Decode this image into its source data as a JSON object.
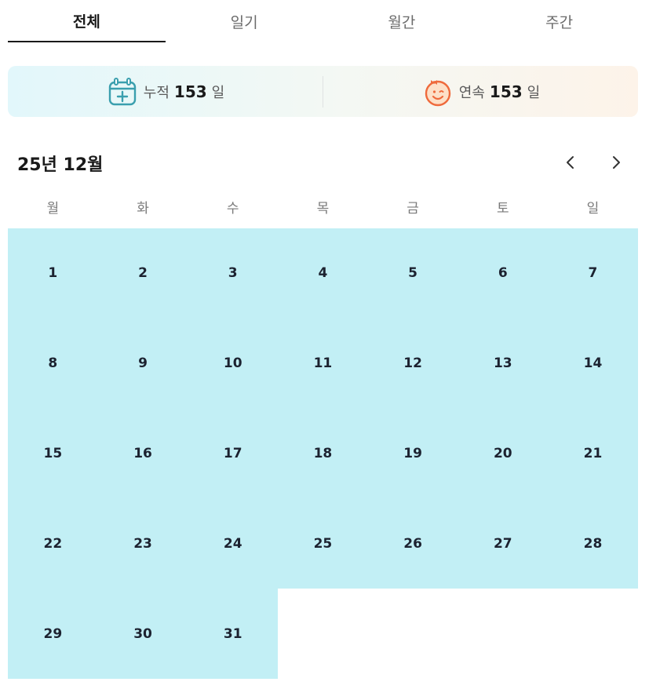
{
  "tabs": [
    {
      "label": "전체",
      "active": true
    },
    {
      "label": "일기",
      "active": false
    },
    {
      "label": "월간",
      "active": false
    },
    {
      "label": "주간",
      "active": false
    }
  ],
  "stats": {
    "cumulative": {
      "label": "누적",
      "value": "153",
      "unit": "일",
      "icon": "calendar-plus-icon"
    },
    "streak": {
      "label": "연속",
      "value": "153",
      "unit": "일",
      "icon": "smiley-face-icon"
    }
  },
  "calendar": {
    "month_title": "25년 12월",
    "prev_icon": "chevron-left-icon",
    "next_icon": "chevron-right-icon",
    "weekdays": [
      "월",
      "화",
      "수",
      "목",
      "금",
      "토",
      "일"
    ],
    "weeks": [
      [
        "1",
        "2",
        "3",
        "4",
        "5",
        "6",
        "7"
      ],
      [
        "8",
        "9",
        "10",
        "11",
        "12",
        "13",
        "14"
      ],
      [
        "15",
        "16",
        "17",
        "18",
        "19",
        "20",
        "21"
      ],
      [
        "22",
        "23",
        "24",
        "25",
        "26",
        "27",
        "28"
      ],
      [
        "29",
        "30",
        "31",
        "",
        "",
        "",
        ""
      ]
    ]
  },
  "colors": {
    "day_fill": "#c2eff5",
    "streak_icon": "#ef6a3c",
    "calendar_icon": "#3a9fae"
  }
}
